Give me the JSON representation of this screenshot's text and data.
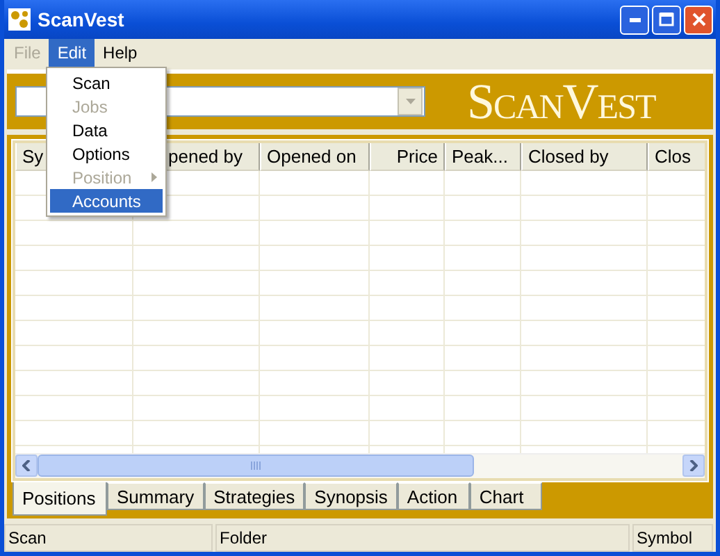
{
  "window": {
    "title": "ScanVest"
  },
  "menu_bar": [
    {
      "label": "File",
      "selected": false,
      "disabled": true
    },
    {
      "label": "Edit",
      "selected": true,
      "disabled": false
    },
    {
      "label": "Help",
      "selected": false,
      "disabled": false
    }
  ],
  "edit_menu": [
    {
      "label": "Scan",
      "disabled": false,
      "selected": false,
      "submenu": false
    },
    {
      "label": "Jobs",
      "disabled": true,
      "selected": false,
      "submenu": false
    },
    {
      "label": "Data",
      "disabled": false,
      "selected": false,
      "submenu": false
    },
    {
      "label": "Options",
      "disabled": false,
      "selected": false,
      "submenu": false
    },
    {
      "label": "Position",
      "disabled": true,
      "selected": false,
      "submenu": true
    },
    {
      "label": "Accounts",
      "disabled": false,
      "selected": true,
      "submenu": false
    }
  ],
  "logo": "ScanVest",
  "table": {
    "columns": [
      {
        "label": "Sy"
      },
      {
        "label": "pened by"
      },
      {
        "label": "Opened on"
      },
      {
        "label": "Price"
      },
      {
        "label": "Peak..."
      },
      {
        "label": "Closed by"
      },
      {
        "label": "Clos"
      }
    ]
  },
  "tabs": [
    {
      "label": "Positions",
      "selected": true
    },
    {
      "label": "Summary",
      "selected": false
    },
    {
      "label": "Strategies",
      "selected": false
    },
    {
      "label": "Synopsis",
      "selected": false
    },
    {
      "label": "Action",
      "selected": false
    },
    {
      "label": "Chart",
      "selected": false
    }
  ],
  "status_bar": [
    "Scan",
    "Folder",
    "Symbol"
  ]
}
